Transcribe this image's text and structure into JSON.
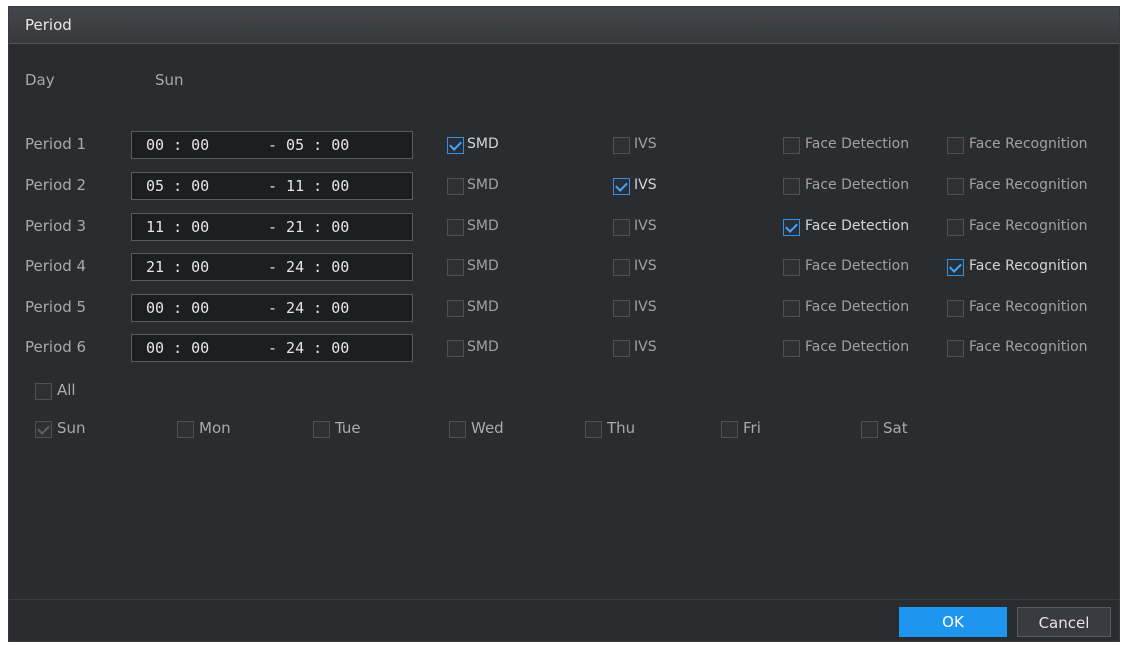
{
  "dialog": {
    "title": "Period"
  },
  "day": {
    "label": "Day",
    "value": "Sun"
  },
  "periods": [
    {
      "label": "Period 1",
      "start": "00 : 00",
      "end": "- 05 : 00",
      "smd": true,
      "ivs": false,
      "face_detection": false,
      "face_recognition": false
    },
    {
      "label": "Period 2",
      "start": "05 : 00",
      "end": "- 11 : 00",
      "smd": false,
      "ivs": true,
      "face_detection": false,
      "face_recognition": false
    },
    {
      "label": "Period 3",
      "start": "11 : 00",
      "end": "- 21 : 00",
      "smd": false,
      "ivs": false,
      "face_detection": true,
      "face_recognition": false
    },
    {
      "label": "Period 4",
      "start": "21 : 00",
      "end": "- 24 : 00",
      "smd": false,
      "ivs": false,
      "face_detection": false,
      "face_recognition": true
    },
    {
      "label": "Period 5",
      "start": "00 : 00",
      "end": "- 24 : 00",
      "smd": false,
      "ivs": false,
      "face_detection": false,
      "face_recognition": false
    },
    {
      "label": "Period 6",
      "start": "00 : 00",
      "end": "- 24 : 00",
      "smd": false,
      "ivs": false,
      "face_detection": false,
      "face_recognition": false
    }
  ],
  "options": {
    "smd": "SMD",
    "ivs": "IVS",
    "face_detection": "Face Detection",
    "face_recognition": "Face Recognition"
  },
  "copy_to": {
    "all_label": "All",
    "days": [
      {
        "label": "Sun",
        "checked": true,
        "disabled": true
      },
      {
        "label": "Mon",
        "checked": false
      },
      {
        "label": "Tue",
        "checked": false
      },
      {
        "label": "Wed",
        "checked": false
      },
      {
        "label": "Thu",
        "checked": false
      },
      {
        "label": "Fri",
        "checked": false
      },
      {
        "label": "Sat",
        "checked": false
      }
    ]
  },
  "buttons": {
    "ok": "OK",
    "cancel": "Cancel"
  },
  "colors": {
    "accent": "#1e96f0",
    "background": "#2b2c30",
    "checkbox_checked": "#4aa3f0"
  }
}
